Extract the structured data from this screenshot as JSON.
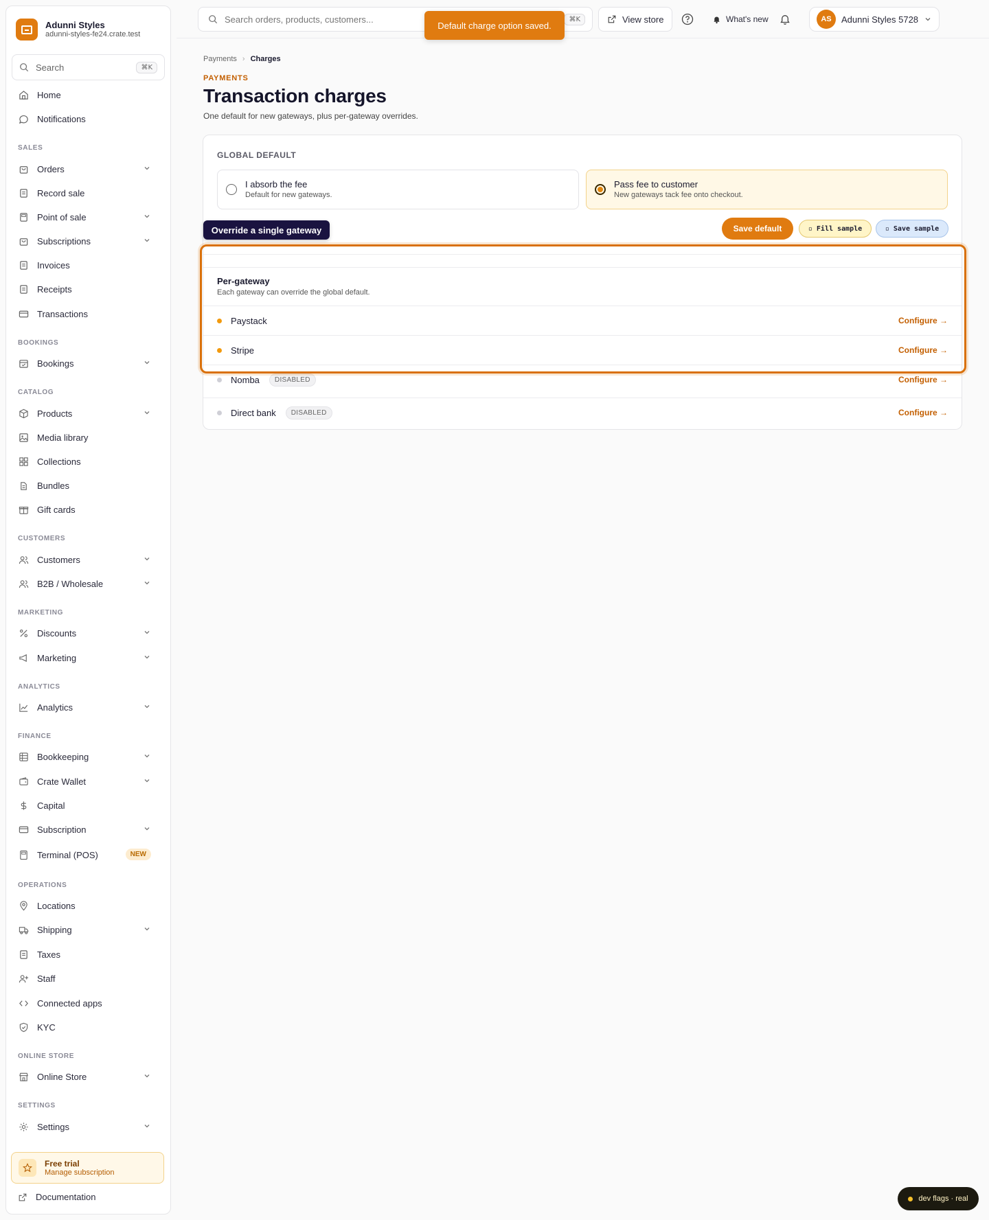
{
  "brand": {
    "name": "Adunni Styles",
    "domain": "adunni-styles-fe24.crate.test"
  },
  "sidebar": {
    "search_label": "Search",
    "search_kbd": "⌘K",
    "top": [
      {
        "label": "Home",
        "icon": "home-icon"
      },
      {
        "label": "Notifications",
        "icon": "chat-bubble-icon"
      }
    ],
    "sections": {
      "sales": "SALES",
      "bookings": "BOOKINGS",
      "catalog": "CATALOG",
      "customers": "CUSTOMERS",
      "marketing": "MARKETING",
      "analytics": "ANALYTICS",
      "finance": "FINANCE",
      "operations": "OPERATIONS",
      "online_store": "ONLINE STORE",
      "settings": "SETTINGS"
    },
    "items": {
      "orders": "Orders",
      "record_sale": "Record sale",
      "point_of_sale": "Point of sale",
      "subscriptions": "Subscriptions",
      "invoices": "Invoices",
      "receipts": "Receipts",
      "transactions": "Transactions",
      "bookings": "Bookings",
      "products": "Products",
      "media_library": "Media library",
      "collections": "Collections",
      "bundles": "Bundles",
      "gift_cards": "Gift cards",
      "customers": "Customers",
      "b2b": "B2B / Wholesale",
      "discounts": "Discounts",
      "marketing": "Marketing",
      "analytics": "Analytics",
      "bookkeeping": "Bookkeeping",
      "crate_wallet": "Crate Wallet",
      "capital": "Capital",
      "subscription": "Subscription",
      "terminal": "Terminal (POS)",
      "locations": "Locations",
      "shipping": "Shipping",
      "taxes": "Taxes",
      "staff": "Staff",
      "connected_apps": "Connected apps",
      "kyc": "KYC",
      "online_store": "Online Store",
      "settings": "Settings"
    },
    "terminal_badge": "NEW",
    "trial": {
      "title": "Free trial",
      "subtitle": "Manage subscription"
    },
    "docs": "Documentation"
  },
  "topbar": {
    "search_placeholder": "Search orders, products, customers...",
    "search_kbd": "⌘K",
    "view_store": "View store",
    "whats_new": "What's new",
    "avatar_initials": "AS",
    "account_name": "Adunni Styles 5728"
  },
  "toast": "Default charge option saved.",
  "page": {
    "breadcrumb": [
      "Payments",
      "Charges"
    ],
    "eyebrow": "PAYMENTS",
    "title": "Transaction charges",
    "description": "One default for new gateways, plus per-gateway overrides."
  },
  "global_default": {
    "label": "GLOBAL DEFAULT",
    "options": [
      {
        "title": "I absorb the fee",
        "subtitle": "Default for new gateways.",
        "selected": false
      },
      {
        "title": "Pass fee to customer",
        "subtitle": "New gateways tack fee onto checkout.",
        "selected": true
      }
    ],
    "save_label": "Save default",
    "fill_sample": "▫ Fill sample",
    "save_sample": "▫ Save sample"
  },
  "tooltip": "Override a single gateway",
  "per_gateway": {
    "title": "Per-gateway",
    "subtitle": "Each gateway can override the global default.",
    "configure_label": "Configure →",
    "disabled_label": "DISABLED",
    "gateways": [
      {
        "name": "Paystack",
        "status": "active",
        "dot_color": "#f29a0e"
      },
      {
        "name": "Stripe",
        "status": "active",
        "dot_color": "#f29a0e"
      },
      {
        "name": "Nomba",
        "status": "disabled",
        "dot_color": "#cfcfd6"
      },
      {
        "name": "Direct bank",
        "status": "disabled",
        "dot_color": "#cfcfd6"
      }
    ]
  },
  "dev_flags": "dev flags · real",
  "colors": {
    "accent": "#e07b10",
    "accent_text": "#c35f00",
    "tooltip_bg": "#1a1340"
  }
}
